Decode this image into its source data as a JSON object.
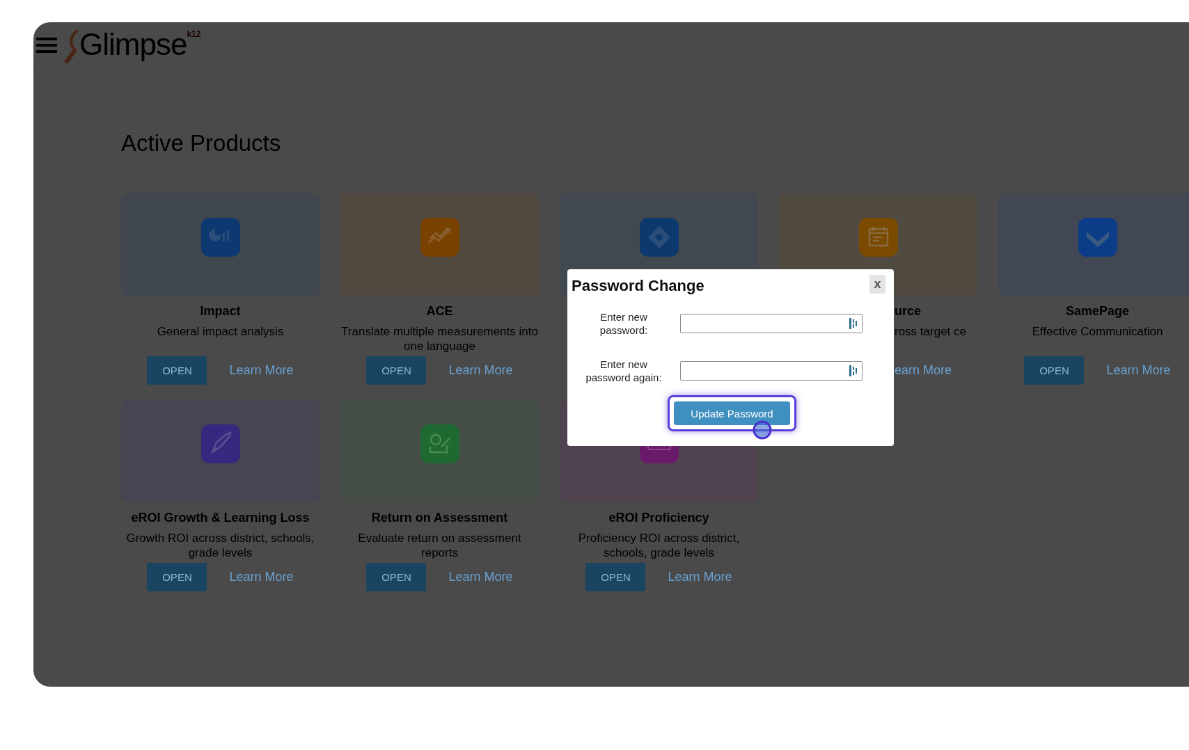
{
  "header": {
    "logo": {
      "name": "Glimpse",
      "superscript": "k12"
    }
  },
  "heading": "Active Products",
  "rows": [
    [
      {
        "color": "#0d3870",
        "title": "Impact",
        "description": "General impact analysis",
        "open": "OPEN",
        "learn": "Learn More"
      },
      {
        "color": "#7a4200",
        "title": "ACE",
        "description": "Translate multiple measurements into one language",
        "open": "OPEN",
        "learn": "Learn More"
      },
      {
        "color": "#0d3a6e"
      },
      {
        "color": "#7a4a00",
        "covered": true,
        "title": "urce",
        "description": "ross target ce",
        "learn": "earn More"
      },
      {
        "color": "#0a3c88",
        "title": "SamePage",
        "description": "Effective Communication",
        "open": "OPEN",
        "learn": "Learn More"
      }
    ],
    [
      {
        "color": "#35287e",
        "title": "eROI Growth & Learning Loss",
        "description": "Growth ROI across district, schools, grade levels",
        "open": "OPEN",
        "learn": "Learn More"
      },
      {
        "color": "#1e6a30",
        "title": "Return on Assessment",
        "description": "Evaluate return on assessment reports",
        "open": "OPEN",
        "learn": "Learn More"
      },
      {
        "color": "#6a1a6a",
        "title": "eROI Proficiency",
        "description": "Proficiency ROI across district, schools, grade levels",
        "open": "OPEN",
        "learn": "Learn More"
      }
    ]
  ],
  "dialog": {
    "title": "Password Change",
    "close": "x",
    "fields": [
      {
        "label": "Enter new password:"
      },
      {
        "label": "Enter new password again:"
      }
    ],
    "button": {
      "label": "Update Password",
      "focused": true
    }
  }
}
